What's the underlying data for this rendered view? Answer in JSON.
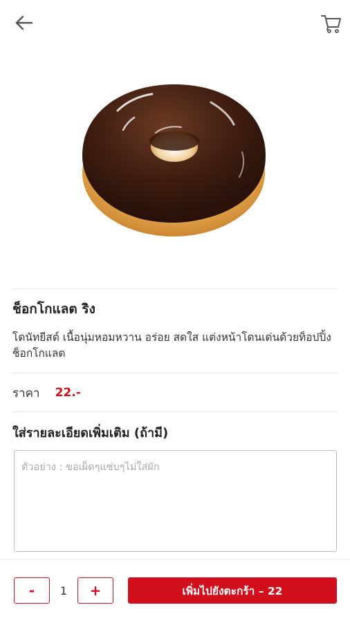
{
  "header": {
    "back_icon": "arrow-left-icon",
    "cart_icon": "shopping-cart-icon"
  },
  "product": {
    "image": "chocolate-ring-donut",
    "name": "ช็อกโกแลต ริง",
    "description": "โดนัทยีสต์ เนื้อนุ่มหอมหวาน อร่อย สดใส แต่งหน้าโดนเด่นด้วยท็อปปิ้งช็อกโกแลต",
    "price_label": "ราคา",
    "price_value": "22.-"
  },
  "note": {
    "title": "ใส่รายละเอียดเพิ่มเติม (ถ้ามี)",
    "placeholder": "ตัวอย่าง : ขอเผ็ดๆแซ่บๆไม่ใส่ผัก",
    "value": ""
  },
  "order": {
    "minus_label": "-",
    "plus_label": "+",
    "quantity": "1",
    "add_to_cart_label": "เพิ่มไปยังตะกร้า – 22"
  },
  "colors": {
    "accent": "#d20f1c",
    "divider": "#e6e6e6"
  }
}
